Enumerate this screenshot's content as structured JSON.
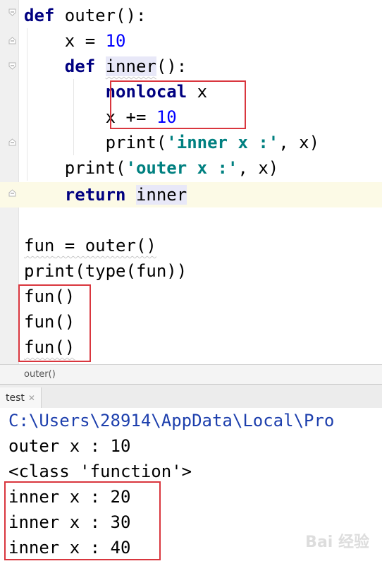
{
  "editor": {
    "lines": {
      "l1": {
        "kw": "def",
        "rest": " outer():"
      },
      "l2": {
        "pre": "    x = ",
        "num": "10"
      },
      "l3": {
        "indent": "    ",
        "kw": "def",
        "sp": " ",
        "name": "inner",
        "rest": "():"
      },
      "l4": {
        "indent": "        ",
        "kw": "nonlocal",
        "rest": " x"
      },
      "l5": {
        "pre": "        x += ",
        "num": "10"
      },
      "l6": {
        "pre": "        print(",
        "str": "'inner x :'",
        "rest": ", x)"
      },
      "l7": {
        "pre": "    print(",
        "str": "'outer x :'",
        "rest": ", x)"
      },
      "l8": {
        "indent": "    ",
        "kw": "return",
        "sp": " ",
        "name": "inner"
      },
      "l10": {
        "var": "fun",
        "rest": " = outer()"
      },
      "l11": {
        "text": "print(type(fun))"
      },
      "l12": {
        "text": "fun()"
      },
      "l13": {
        "text": "fun()"
      },
      "l14": {
        "text": "fun()"
      }
    }
  },
  "breadcrumb": {
    "text": "outer()"
  },
  "run_panel": {
    "tab_label": "test",
    "close_glyph": "✕",
    "output": [
      "C:\\Users\\28914\\AppData\\Local\\Pro",
      "outer x : 10",
      "<class 'function'>",
      "inner x : 20",
      "inner x : 30",
      "inner x : 40"
    ]
  },
  "watermark": "Bai 经验",
  "colors": {
    "keyword": "#000080",
    "number": "#0000ff",
    "string": "#008080",
    "highlight_box": "#d9363e",
    "console_path": "#1d3fad"
  }
}
